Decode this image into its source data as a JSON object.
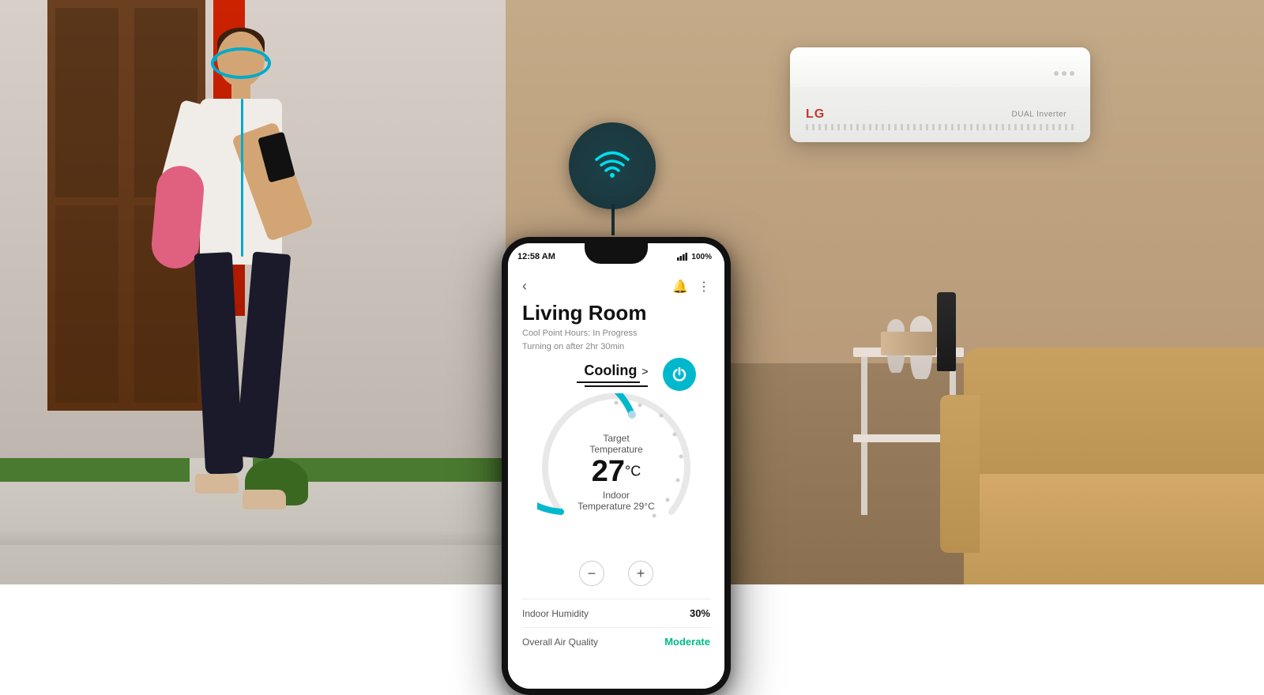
{
  "scene": {
    "left_bg_description": "outdoor home entrance with woman",
    "right_bg_description": "indoor living room with AC unit"
  },
  "wifi_bubble": {
    "icon": "wifi"
  },
  "phone": {
    "status_bar": {
      "time": "12:58 AM",
      "battery": "100%",
      "signal_icon": "signal"
    },
    "app": {
      "title": "Living Room",
      "subtitle_line1": "Cool Point Hours: In Progress",
      "subtitle_line2": "Turning on after 2hr 30min",
      "mode_label": "Cooling",
      "mode_arrow": ">",
      "target_temp_label": "Target Temperature",
      "target_temp_value": "27",
      "target_temp_unit": "°C",
      "indoor_temp_label": "Indoor Temperature 29°C",
      "decrease_btn": "−",
      "increase_btn": "+",
      "humidity_label": "Indoor Humidity",
      "humidity_value": "30%",
      "air_quality_label": "Overall Air Quality",
      "air_quality_value": "Moderate",
      "back_btn": "‹",
      "notification_icon": "🔔",
      "more_icon": "⋮"
    }
  },
  "ac_unit": {
    "brand": "LG",
    "model": "DUAL Inverter"
  }
}
